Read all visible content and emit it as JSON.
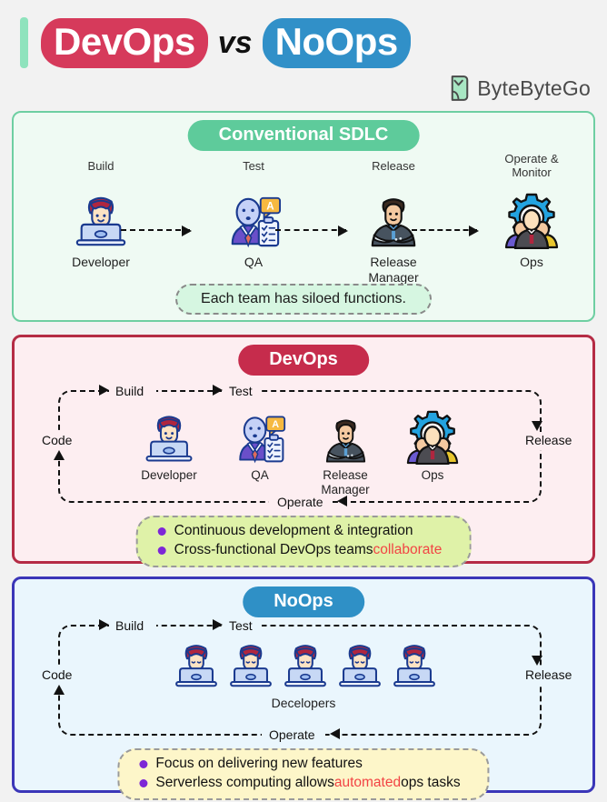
{
  "header": {
    "title_part1": "DevOps",
    "title_vs": "vs",
    "title_part2": "NoOps",
    "brand_name": "ByteByteGo",
    "colors": {
      "devops_accent": "#d63a5b",
      "noops_accent": "#3190c8",
      "accent_bar": "#8fe3bd"
    }
  },
  "panels": {
    "sdlc": {
      "title": "Conventional SDLC",
      "title_color": "#5ecb9b",
      "border_color": "#6ecfa2",
      "background": "#effaf3",
      "stages": [
        {
          "phase": "Build",
          "icon": "developer-icon",
          "role": "Developer"
        },
        {
          "phase": "Test",
          "icon": "qa-icon",
          "role": "QA"
        },
        {
          "phase": "Release",
          "icon": "release-manager-icon",
          "role": "Release\nManager"
        },
        {
          "phase": "Operate &\nMonitor",
          "icon": "ops-gear-icon",
          "role": "Ops"
        }
      ],
      "callout": "Each team has siloed functions."
    },
    "devops": {
      "title": "DevOps",
      "title_color": "#c62c4c",
      "border_color": "#b52c45",
      "background": "#fdeef1",
      "loop_labels": {
        "build": "Build",
        "test": "Test",
        "release": "Release",
        "operate": "Operate",
        "code": "Code"
      },
      "roles": [
        {
          "icon": "developer-icon",
          "label": "Developer"
        },
        {
          "icon": "qa-icon",
          "label": "QA"
        },
        {
          "icon": "release-manager-icon",
          "label": "Release\nManager"
        },
        {
          "icon": "ops-gear-icon",
          "label": "Ops"
        }
      ],
      "bullets": [
        {
          "text": "Continuous development & integration",
          "highlight": ""
        },
        {
          "text": "Cross-functional DevOps teams ",
          "highlight": "collaborate",
          "after": ""
        }
      ]
    },
    "noops": {
      "title": "NoOps",
      "title_color": "#2f90c6",
      "border_color": "#3b36b8",
      "background": "#eaf6fd",
      "loop_labels": {
        "build": "Build",
        "test": "Test",
        "release": "Release",
        "operate": "Operate",
        "code": "Code"
      },
      "team_label": "Decelopers",
      "team_count": 5,
      "bullets": [
        {
          "text": "Focus on delivering new features",
          "highlight": "",
          "after": ""
        },
        {
          "text": "Serverless computing allows ",
          "highlight": "automated",
          "after": " ops tasks"
        }
      ]
    }
  }
}
